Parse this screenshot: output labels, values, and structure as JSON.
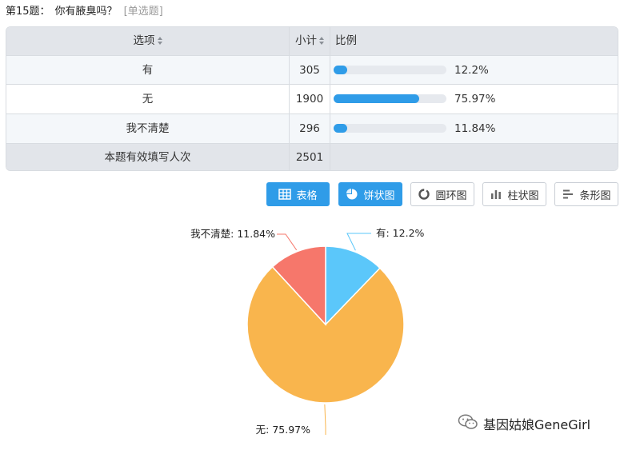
{
  "question": {
    "number": "第15题：",
    "text": "你有腋臭吗？",
    "type": "[单选题]"
  },
  "table": {
    "headers": {
      "option": "选项",
      "count": "小计",
      "ratio": "比例"
    },
    "rows": [
      {
        "option": "有",
        "count": "305",
        "percent_label": "12.2%",
        "percent": 12.2
      },
      {
        "option": "无",
        "count": "1900",
        "percent_label": "75.97%",
        "percent": 75.97
      },
      {
        "option": "我不清楚",
        "count": "296",
        "percent_label": "11.84%",
        "percent": 11.84
      }
    ],
    "total": {
      "label": "本题有效填写人次",
      "count": "2501"
    }
  },
  "view_buttons": [
    {
      "label": "表格",
      "icon": "table-icon",
      "active": true
    },
    {
      "label": "饼状图",
      "icon": "pie-chart-icon",
      "active": true
    },
    {
      "label": "圆环图",
      "icon": "donut-chart-icon",
      "active": false
    },
    {
      "label": "柱状图",
      "icon": "bar-chart-icon",
      "active": false
    },
    {
      "label": "条形图",
      "icon": "horizontal-bar-icon",
      "active": false
    }
  ],
  "colors": {
    "accent": "#2f9ce8",
    "slice_you": "#5bc7fa",
    "slice_wu": "#f9b54d",
    "slice_unsure": "#f6776b"
  },
  "chart_data": {
    "type": "pie",
    "slices": [
      {
        "name": "有",
        "value": 12.2,
        "label": "有: 12.2%",
        "color": "#5bc7fa"
      },
      {
        "name": "无",
        "value": 75.97,
        "label": "无: 75.97%",
        "color": "#f9b54d"
      },
      {
        "name": "我不清楚",
        "value": 11.84,
        "label": "我不清楚: 11.84%",
        "color": "#f6776b"
      }
    ]
  },
  "watermark": {
    "text": "基因姑娘GeneGirl",
    "icon": "wechat-icon"
  }
}
